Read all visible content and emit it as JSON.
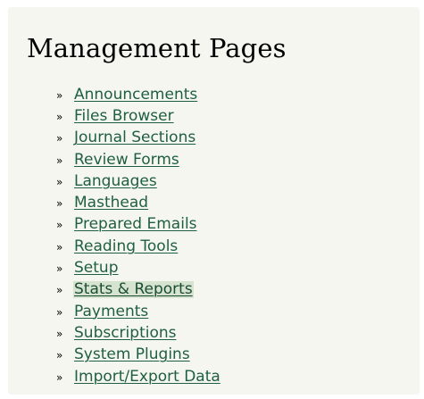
{
  "page": {
    "title": "Management Pages",
    "bullet": "»"
  },
  "links": [
    {
      "label": "Announcements"
    },
    {
      "label": "Files Browser"
    },
    {
      "label": "Journal Sections"
    },
    {
      "label": "Review Forms"
    },
    {
      "label": "Languages"
    },
    {
      "label": "Masthead"
    },
    {
      "label": "Prepared Emails"
    },
    {
      "label": "Reading Tools"
    },
    {
      "label": "Setup"
    },
    {
      "label": "Stats & Reports",
      "highlighted": true
    },
    {
      "label": "Payments"
    },
    {
      "label": "Subscriptions"
    },
    {
      "label": "System Plugins"
    },
    {
      "label": "Import/Export Data"
    }
  ],
  "colors": {
    "panel_background": "#f6f6f0",
    "link_color": "#1f5f41",
    "highlight_background": "#d6e3cf"
  }
}
